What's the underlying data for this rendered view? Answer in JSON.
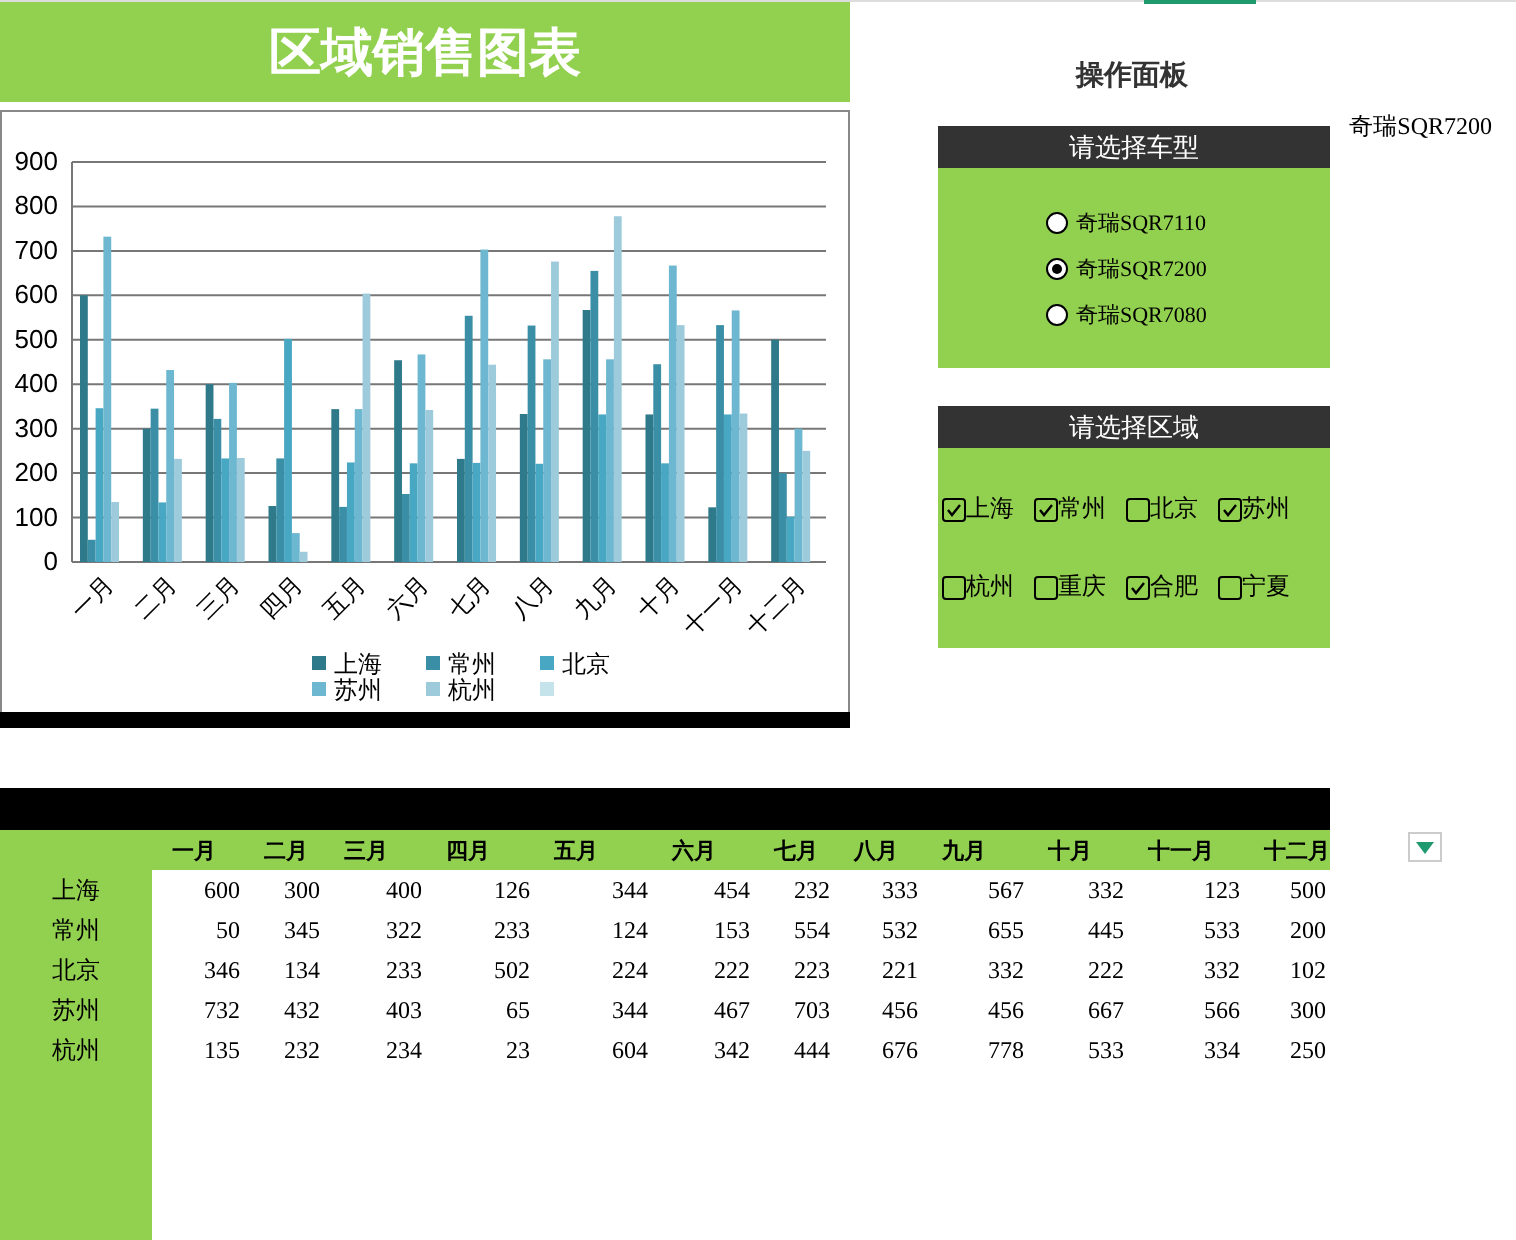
{
  "title": "区域销售图表",
  "chart": {
    "chart_data": {
      "type": "bar",
      "categories": [
        "一月",
        "二月",
        "三月",
        "四月",
        "五月",
        "六月",
        "七月",
        "八月",
        "九月",
        "十月",
        "十一月",
        "十二月"
      ],
      "yticks": [
        0,
        100,
        200,
        300,
        400,
        500,
        600,
        700,
        800,
        900
      ],
      "ylim": [
        0,
        900
      ],
      "grid": true,
      "legend": "bottom",
      "series": [
        {
          "name": "上海",
          "color": "#2f7a8a",
          "values": [
            600,
            300,
            400,
            126,
            344,
            454,
            232,
            333,
            567,
            332,
            123,
            500
          ]
        },
        {
          "name": "常州",
          "color": "#3a8fa6",
          "values": [
            50,
            345,
            322,
            233,
            124,
            153,
            554,
            532,
            655,
            445,
            533,
            200
          ]
        },
        {
          "name": "北京",
          "color": "#48a7c2",
          "values": [
            346,
            134,
            233,
            502,
            224,
            222,
            223,
            221,
            332,
            222,
            332,
            102
          ]
        },
        {
          "name": "苏州",
          "color": "#6db7d0",
          "values": [
            732,
            432,
            403,
            65,
            344,
            467,
            703,
            456,
            456,
            667,
            566,
            300
          ]
        },
        {
          "name": "杭州",
          "color": "#9ecbdc",
          "values": [
            135,
            232,
            234,
            23,
            604,
            342,
            444,
            676,
            778,
            533,
            334,
            250
          ]
        }
      ]
    }
  },
  "panel": {
    "title": "操作面板",
    "current": "奇瑞SQR7200",
    "car_section": {
      "header": "请选择车型",
      "options": [
        {
          "label": "奇瑞SQR7110",
          "selected": false
        },
        {
          "label": "奇瑞SQR7200",
          "selected": true
        },
        {
          "label": "奇瑞SQR7080",
          "selected": false
        }
      ]
    },
    "region_section": {
      "header": "请选择区域",
      "options": [
        {
          "label": "上海",
          "checked": true
        },
        {
          "label": "常州",
          "checked": true
        },
        {
          "label": "北京",
          "checked": false
        },
        {
          "label": "苏州",
          "checked": true
        },
        {
          "label": "杭州",
          "checked": false
        },
        {
          "label": "重庆",
          "checked": false
        },
        {
          "label": "合肥",
          "checked": true
        },
        {
          "label": "宁夏",
          "checked": false
        }
      ]
    }
  },
  "table": {
    "columns": [
      "一月",
      "二月",
      "三月",
      "四月",
      "五月",
      "六月",
      "七月",
      "八月",
      "九月",
      "十月",
      "十一月",
      "十二月"
    ],
    "rows": [
      {
        "name": "上海",
        "values": [
          "600",
          "300",
          "400",
          "126",
          "344",
          "454",
          "232",
          "333",
          "567",
          "332",
          "123",
          "500"
        ]
      },
      {
        "name": "常州",
        "values": [
          "50",
          "345",
          "322",
          "233",
          "124",
          "153",
          "554",
          "532",
          "655",
          "445",
          "533",
          "200"
        ]
      },
      {
        "name": "北京",
        "values": [
          "346",
          "134",
          "233",
          "502",
          "224",
          "222",
          "223",
          "221",
          "332",
          "222",
          "332",
          "102"
        ]
      },
      {
        "name": "苏州",
        "values": [
          "732",
          "432",
          "403",
          "65",
          "344",
          "467",
          "703",
          "456",
          "456",
          "667",
          "566",
          "300"
        ]
      },
      {
        "name": "杭州",
        "values": [
          "135",
          "232",
          "234",
          "23",
          "604",
          "342",
          "444",
          "676",
          "778",
          "533",
          "334",
          "250"
        ]
      }
    ]
  }
}
